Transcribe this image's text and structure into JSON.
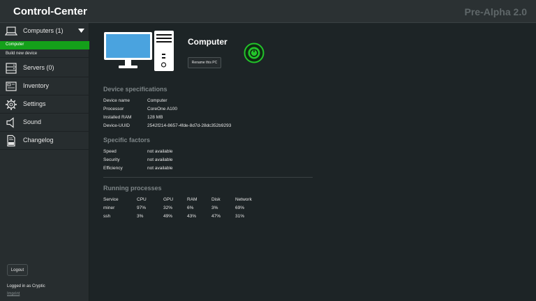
{
  "app": {
    "title": "Control-Center",
    "version": "Pre-Alpha 2.0"
  },
  "sidebar": {
    "computers": {
      "label": "Computers (1)",
      "sub_active": "Computer",
      "sub_build": "Build new device"
    },
    "servers": "Servers (0)",
    "inventory": "Inventory",
    "settings": "Settings",
    "sound": "Sound",
    "changelog": "Changelog",
    "logout": "Logout",
    "logged_in": "Logged in as Cryptic",
    "imprint": "Imprint"
  },
  "device": {
    "name": "Computer",
    "rename_label": "Rename this PC",
    "power_color": "#22c42a"
  },
  "specs": {
    "title": "Device specifications",
    "rows": [
      {
        "key": "Device name",
        "value": "Computer"
      },
      {
        "key": "Processor",
        "value": "CoreOne A100"
      },
      {
        "key": "Installed RAM",
        "value": "128 MB"
      },
      {
        "key": "Device-UUID",
        "value": "2542f214-8657-4fde-8d7d-28dc352b9293"
      }
    ]
  },
  "factors": {
    "title": "Specific factors",
    "rows": [
      {
        "key": "Speed",
        "value": "not available"
      },
      {
        "key": "Security",
        "value": "not available"
      },
      {
        "key": "Efficiency",
        "value": "not available"
      }
    ]
  },
  "processes": {
    "title": "Running processes",
    "headers": [
      "Service",
      "CPU",
      "GPU",
      "RAM",
      "Disk",
      "Network"
    ],
    "rows": [
      [
        "miner",
        "97%",
        "32%",
        "6%",
        "3%",
        "69%"
      ],
      [
        "ssh",
        "3%",
        "49%",
        "43%",
        "47%",
        "31%"
      ]
    ]
  }
}
